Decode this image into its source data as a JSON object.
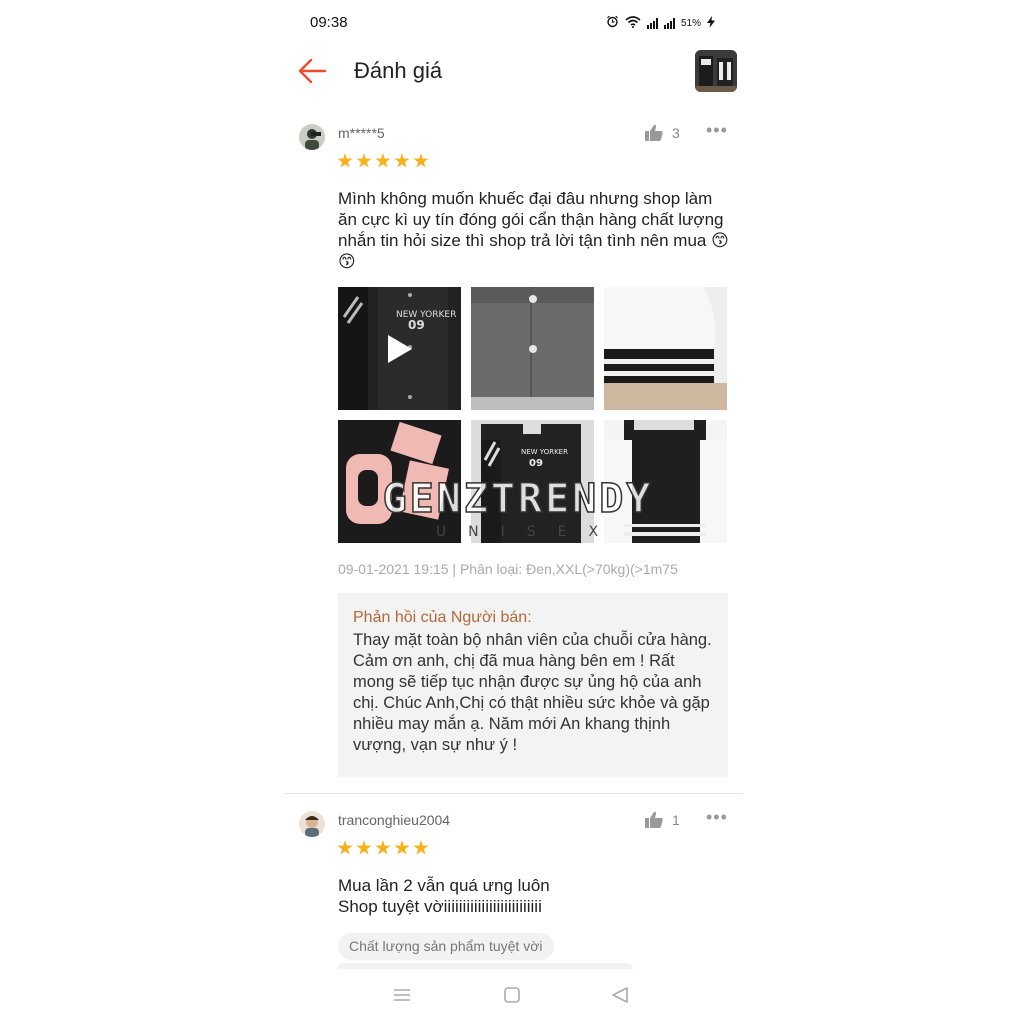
{
  "status_bar": {
    "time": "09:38",
    "battery": "51%"
  },
  "header": {
    "title": "Đánh giá",
    "back_icon": "arrow-left-icon",
    "accent_color": "#ee4d2d"
  },
  "reviews": [
    {
      "username": "m*****5",
      "likes": "3",
      "rating": 5,
      "text": "Mình không muốn khuếc đại đâu nhưng shop làm ăn cực kì uy tín đóng gói cẩn thận hàng chất lượng nhắn tin hỏi size  thì shop trả lời tận tình nên mua 😙😙",
      "meta": "09-01-2021 19:15 | Phân loại: Đen,XXL(>70kg)(>1m75",
      "reply_title": "Phản hồi của Người bán:",
      "reply_text": "Thay mặt toàn bộ nhân viên của chuỗi cửa hàng. Cảm ơn anh, chị đã mua hàng bên em ! Rất mong sẽ tiếp tục nhận được sự ủng hộ của anh chị. Chúc Anh,Chị có thật nhiều sức khỏe và gặp nhiều may mắn ạ. Năm mới An khang thịnh vượng, vạn sự như ý !",
      "watermark_main": "GENZTRENDY",
      "watermark_sub": "UNISEX"
    },
    {
      "username": "tranconghieu2004",
      "likes": "1",
      "rating": 5,
      "text": "Mua lần 2 vẫn quá ưng luôn\nShop tuyệt vờiiiiiiiiiiiiiiiiiiiiiiiiii",
      "tag": "Chất lượng sản phẩm tuyệt vời"
    }
  ]
}
